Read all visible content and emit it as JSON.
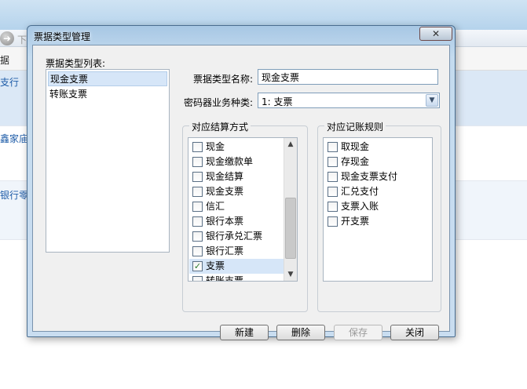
{
  "background": {
    "nav_text": "下",
    "toolbar_text": "据",
    "links": [
      "支行",
      "鑫家庙信",
      "银行零余"
    ]
  },
  "dialog": {
    "title": "票据类型管理",
    "close_label": "✕",
    "list_label": "票据类型列表:",
    "types": [
      "现金支票",
      "转账支票"
    ],
    "selected_type_index": 0,
    "name_label": "票据类型名称:",
    "name_value": "现金支票",
    "password_label": "密码器业务种类:",
    "password_value": "1: 支票",
    "settlement": {
      "title": "对应结算方式",
      "items": [
        {
          "label": "现金",
          "checked": false
        },
        {
          "label": "现金缴款单",
          "checked": false
        },
        {
          "label": "现金结算",
          "checked": false
        },
        {
          "label": "现金支票",
          "checked": false
        },
        {
          "label": "信汇",
          "checked": false
        },
        {
          "label": "银行本票",
          "checked": false
        },
        {
          "label": "银行承兑汇票",
          "checked": false
        },
        {
          "label": "银行汇票",
          "checked": false
        },
        {
          "label": "支票",
          "checked": true
        },
        {
          "label": "转账支票",
          "checked": false
        }
      ]
    },
    "accounting": {
      "title": "对应记账规则",
      "items": [
        {
          "label": "取现金",
          "checked": false
        },
        {
          "label": "存现金",
          "checked": false
        },
        {
          "label": "现金支票支付",
          "checked": false
        },
        {
          "label": "汇兑支付",
          "checked": false
        },
        {
          "label": "支票入账",
          "checked": false
        },
        {
          "label": "开支票",
          "checked": false
        }
      ]
    },
    "buttons": {
      "new": "新建",
      "delete": "删除",
      "save": "保存",
      "close": "关闭"
    }
  }
}
